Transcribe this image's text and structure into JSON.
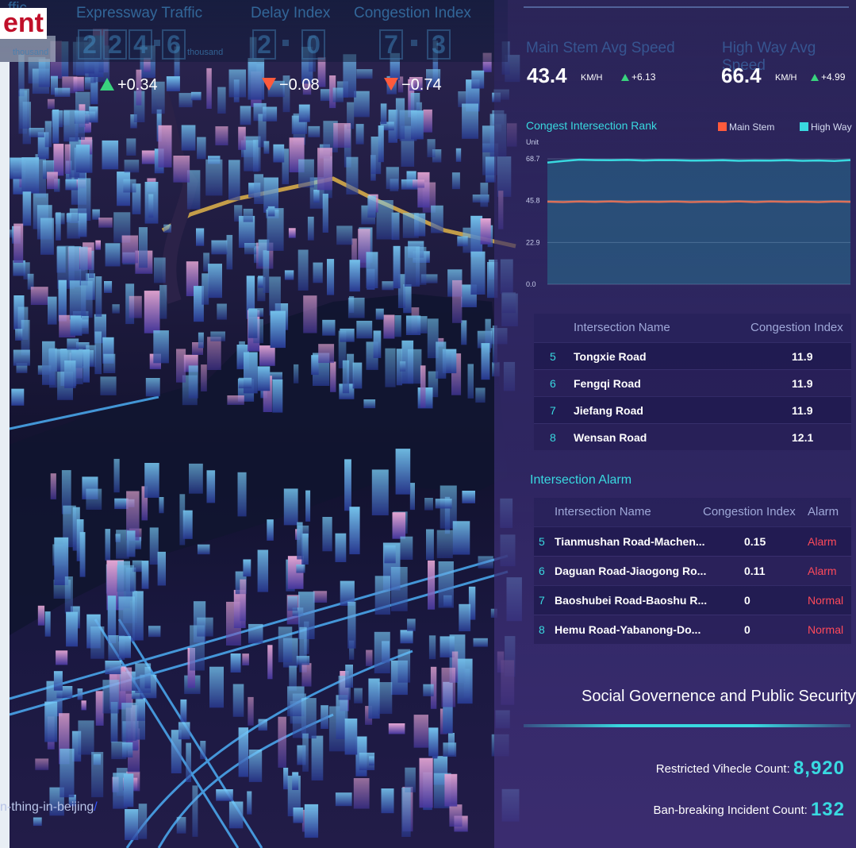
{
  "header": {
    "title_fragment": "ent",
    "left_ghost_label": "ffic",
    "left_ghost_unit": "thousand",
    "metrics": [
      {
        "label": "Expressway Traffic",
        "digits": [
          "2",
          "2",
          "4",
          "6"
        ],
        "unit": "thousand",
        "delta": "+0.34",
        "direction": "up"
      },
      {
        "label": "Delay Index",
        "digits": [
          "2",
          "0"
        ],
        "unit": "",
        "delta": "−0.08",
        "direction": "down"
      },
      {
        "label": "Congestion Index",
        "digits": [
          "7",
          "3"
        ],
        "unit": "",
        "delta": "−0.74",
        "direction": "down"
      }
    ]
  },
  "speeds": {
    "main_stem": {
      "label": "Main Stem Avg Speed",
      "value": "43.4",
      "unit": "KM/H",
      "delta": "+6.13"
    },
    "high_way": {
      "label": "High Way Avg Speed",
      "value": "66.4",
      "unit": "KM/H",
      "delta": "+4.99"
    }
  },
  "chart_data": {
    "type": "line",
    "title": "Congest Intersection Rank",
    "ylabel": "Unit",
    "yticks": [
      "68.7",
      "45.8",
      "22.9",
      "0.0"
    ],
    "ylim": [
      0,
      68.7
    ],
    "series": [
      {
        "name": "Main Stem",
        "color": "#ff5a3c",
        "values": [
          45.2,
          45.0,
          45.3,
          45.1,
          45.4,
          45.0,
          45.2,
          45.1,
          45.3,
          45.0,
          45.2,
          45.1,
          45.4,
          45.0,
          45.3,
          45.1,
          45.2,
          45.0,
          45.3,
          45.1
        ]
      },
      {
        "name": "High Way",
        "color": "#39d9e0",
        "values": [
          66.6,
          67.5,
          68.2,
          68.0,
          67.9,
          68.1,
          67.8,
          68.0,
          67.9,
          67.7,
          67.8,
          67.9,
          67.6,
          67.8,
          67.7,
          67.9,
          67.6,
          67.8,
          67.5,
          68.0
        ]
      }
    ]
  },
  "rank_table": {
    "headers": [
      "Intersection Name",
      "Congestion Index"
    ],
    "rows": [
      {
        "rank": "5",
        "name": "Tongxie Road",
        "index": "11.9"
      },
      {
        "rank": "6",
        "name": "Fengqi Road",
        "index": "11.9"
      },
      {
        "rank": "7",
        "name": "Jiefang Road",
        "index": "11.9"
      },
      {
        "rank": "8",
        "name": "Wensan Road",
        "index": "12.1"
      }
    ]
  },
  "alarm": {
    "title": "Intersection Alarm",
    "headers": [
      "Intersection Name",
      "Congestion Index",
      "Alarm"
    ],
    "rows": [
      {
        "rank": "5",
        "name": "Tianmushan Road-Machen...",
        "index": "0.15",
        "status": "Alarm"
      },
      {
        "rank": "6",
        "name": "Daguan Road-Jiaogong Ro...",
        "index": "0.11",
        "status": "Alarm"
      },
      {
        "rank": "7",
        "name": "Baoshubei Road-Baoshu R...",
        "index": "0",
        "status": "Normal"
      },
      {
        "rank": "8",
        "name": "Hemu Road-Yabanong-Do...",
        "index": "0",
        "status": "Normal"
      }
    ]
  },
  "social": {
    "title": "Social Governence and Public Security",
    "restricted_label": "Restricted Vihecle Count:",
    "restricted_value": "8,920",
    "ban_label": "Ban-breaking Incident Count:",
    "ban_value": "132"
  },
  "footer": {
    "url_fragment": "n-thing-in-beijing",
    "url_link": "/"
  },
  "colors": {
    "accent_cyan": "#39d9e0",
    "alarm_red": "#ff4a5a",
    "up_green": "#39d37e",
    "down_orange": "#ff5a3c",
    "title_red": "#c0102a"
  }
}
